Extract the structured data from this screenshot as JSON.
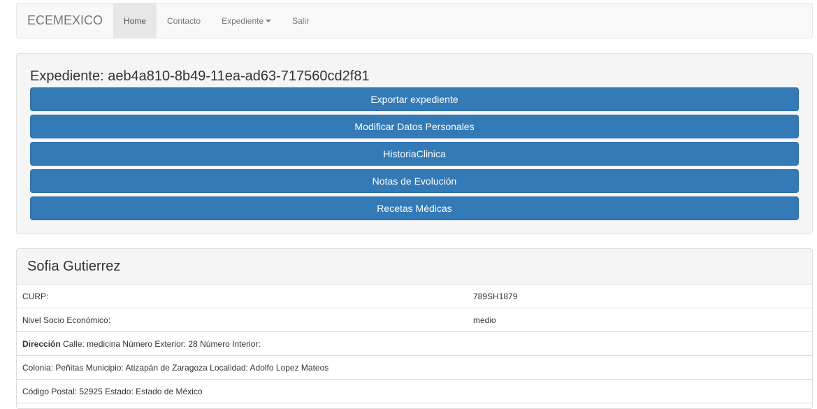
{
  "navbar": {
    "brand": "ECEMEXICO",
    "items": [
      {
        "label": "Home"
      },
      {
        "label": "Contacto"
      },
      {
        "label": "Expediente"
      },
      {
        "label": "Salir"
      }
    ]
  },
  "expediente": {
    "title": "Expediente: aeb4a810-8b49-11ea-ad63-717560cd2f81",
    "buttons": [
      {
        "label": "Exportar expediente"
      },
      {
        "label": "Modificar Datos Personales"
      },
      {
        "label": "HistoriaClinica"
      },
      {
        "label": "Notas de Evolución"
      },
      {
        "label": "Recetas Médicas"
      }
    ]
  },
  "patient": {
    "name": "Sofia Gutierrez",
    "curp_label": "CURP:",
    "curp_value": "789SH1879",
    "nivel_label": "Nivel Socio Económico:",
    "nivel_value": "medio",
    "direccion_label": "Dirección",
    "direccion_text": " Calle: medicina Número Exterior: 28 Número Interior:",
    "colonia_text": "Colonia: Peñitas Municipio: Atizapán de Zaragoza Localidad: Adolfo Lopez Mateos",
    "cp_text": "Código Postal: 52925 Estado: Estado de México"
  }
}
